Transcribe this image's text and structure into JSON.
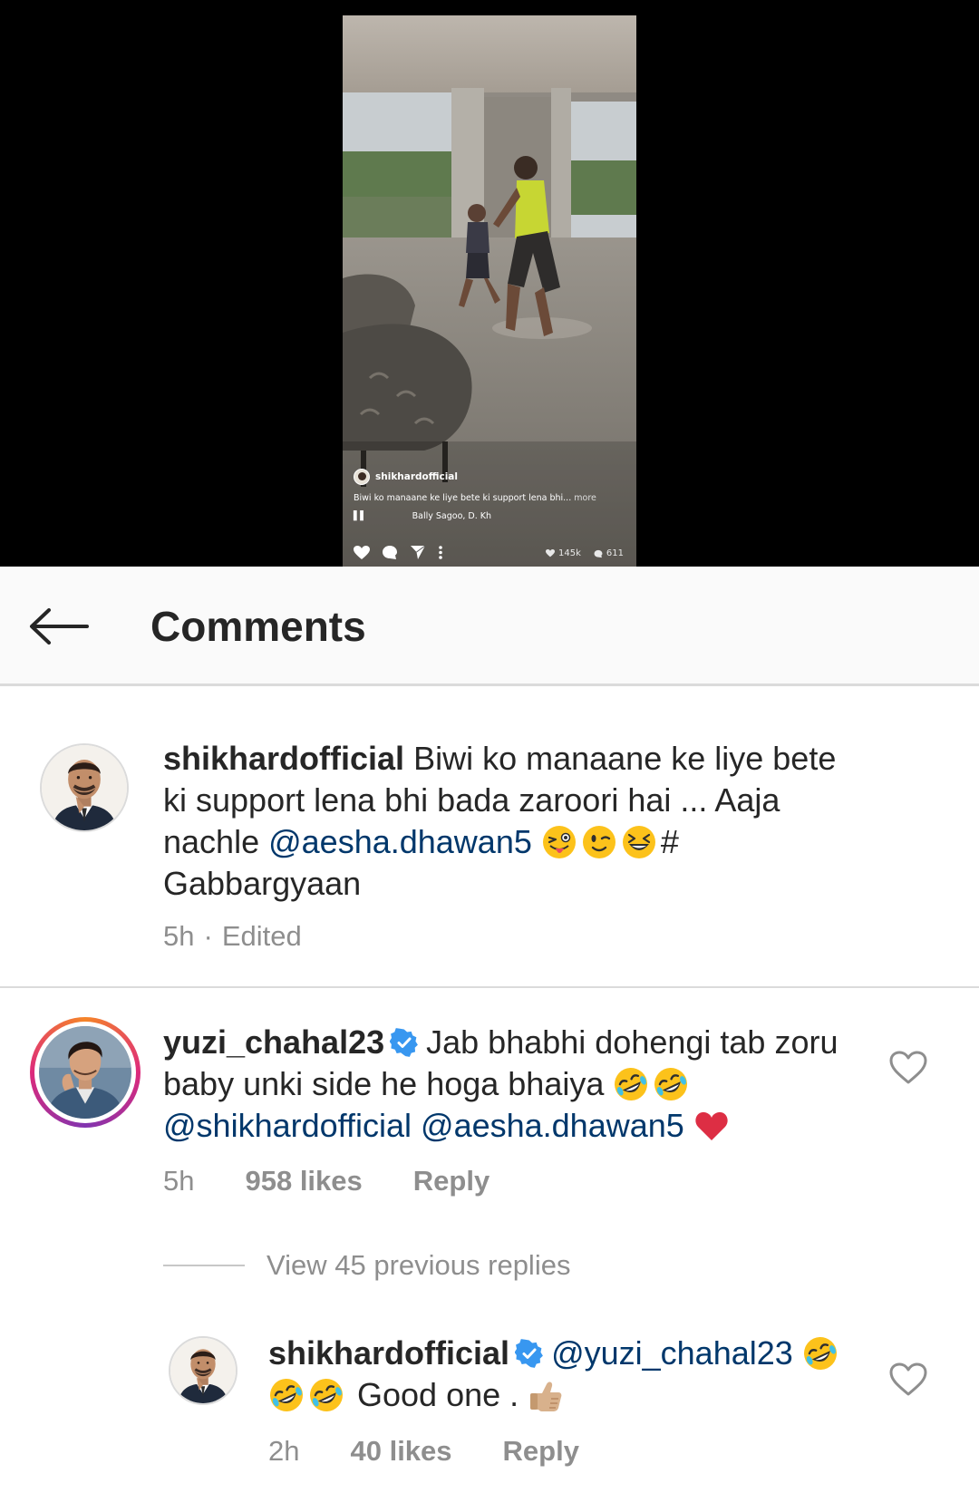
{
  "reel": {
    "username": "shikhardofficial",
    "caption": "Biwi ko manaane ke liye bete ki support lena bhi...",
    "more_label": "more",
    "audio_icon_text": "▌▌",
    "audio_label": "Bally Sagoo, D. Kh",
    "likes": "145k",
    "comments": "611"
  },
  "header": {
    "title": "Comments"
  },
  "caption_comment": {
    "username": "shikhardofficial",
    "text_part1": "Biwi ko manaane ke liye bete ki support lena bhi bada zaroori hai ... Aaja nachle",
    "mention": "@aesha.dhawan5",
    "emojis": [
      "winking-tongue-emoji",
      "winking-face-emoji",
      "laughing-squint-emoji"
    ],
    "text_part2": "# Gabbargyaan",
    "time": "5h",
    "separator": "·",
    "edited_label": "Edited"
  },
  "comment1": {
    "username": "yuzi_chahal23",
    "verified": true,
    "text": "Jab bhabhi dohengi tab zoru baby  unki side he hoga bhaiya",
    "emojis": [
      "rolling-laughing-emoji",
      "rolling-laughing-emoji"
    ],
    "mention1": "@shikhardofficial",
    "mention2": "@aesha.dhawan5",
    "end_emoji": "red-heart-emoji",
    "time": "5h",
    "likes": "958 likes",
    "reply_label": "Reply"
  },
  "view_replies": {
    "label": "View 45 previous replies"
  },
  "reply1": {
    "username": "shikhardofficial",
    "verified": true,
    "mention": "@yuzi_chahal23",
    "emojis": [
      "rolling-laughing-emoji",
      "rolling-laughing-emoji",
      "rolling-laughing-emoji"
    ],
    "text": "Good one .",
    "end_emoji": "thumbs-up-emoji",
    "time": "2h",
    "likes": "40 likes",
    "reply_label": "Reply"
  },
  "colors": {
    "mention": "#00376b",
    "secondary_text": "#8e8e8e",
    "verified_blue": "#3897f0",
    "heart_red": "#ed4956",
    "header_bg": "#fafafa"
  }
}
